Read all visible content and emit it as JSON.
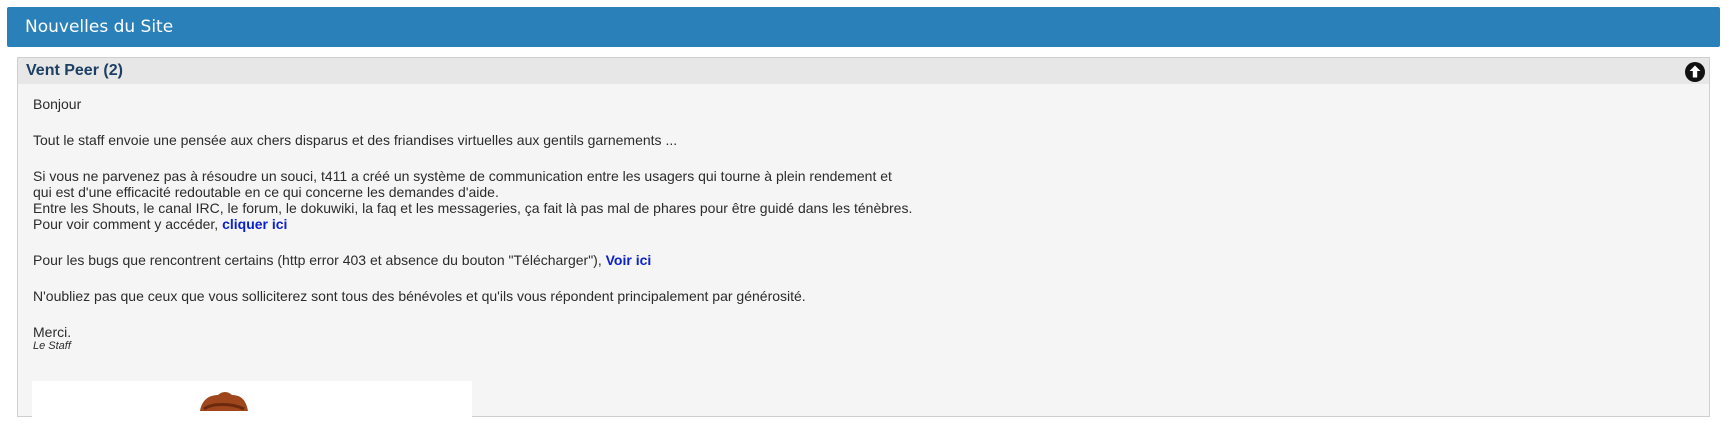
{
  "header": {
    "title": "Nouvelles du Site"
  },
  "panel": {
    "title": "Vent Peer (2)",
    "collapse_icon": "arrow-up-circle-icon",
    "greeting": "Bonjour",
    "para1": "Tout le staff envoie une pensée aux chers disparus et des friandises virtuelles aux gentils garnements ...",
    "para2_line1": "Si vous ne parvenez pas à résoudre un souci, t411 a créé un système de communication entre les usagers qui tourne à plein rendement et",
    "para2_line2": "qui est d'une efficacité redoutable en ce qui concerne les demandes d'aide.",
    "para2_line3": "Entre les Shouts, le canal IRC, le forum, le dokuwiki, la faq et les messageries, ça fait là pas mal de phares pour être guidé dans les ténèbres.",
    "para2_line4": "Pour voir comment y accéder, ",
    "para2_link": "cliquer ici",
    "para3_text": "Pour les bugs que rencontrent certains (http error 403 et absence du bouton \"Télécharger\"), ",
    "para3_link": "Voir ici",
    "para4": "N'oubliez pas que ceux que vous solliciterez sont tous des bénévoles et qu'ils vous répondent principalement par générosité.",
    "thanks": "Merci.",
    "signature": "Le Staff"
  },
  "colors": {
    "header_bg": "#2a80b9",
    "link": "#0b21c9",
    "title": "#1d3f63"
  }
}
